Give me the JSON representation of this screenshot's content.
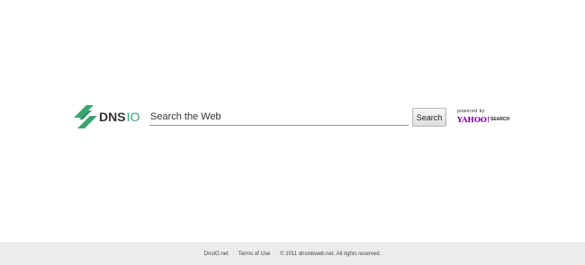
{
  "logo": {
    "text_main": "DNS",
    "text_accent": "IO",
    "brand_color": "#3aa573"
  },
  "search": {
    "placeholder": "Search the Web",
    "value": "",
    "button_label": "Search"
  },
  "powered_by": {
    "label": "powered by",
    "provider": "YAHOO!",
    "provider_suffix": "SEARCH",
    "provider_color": "#7b0099"
  },
  "footer": {
    "links": [
      "DnsIO.net",
      "Terms of Use"
    ],
    "copyright": "© 2011 dnsiobweb.net. All rights reserved.",
    "background": "#ececec"
  }
}
